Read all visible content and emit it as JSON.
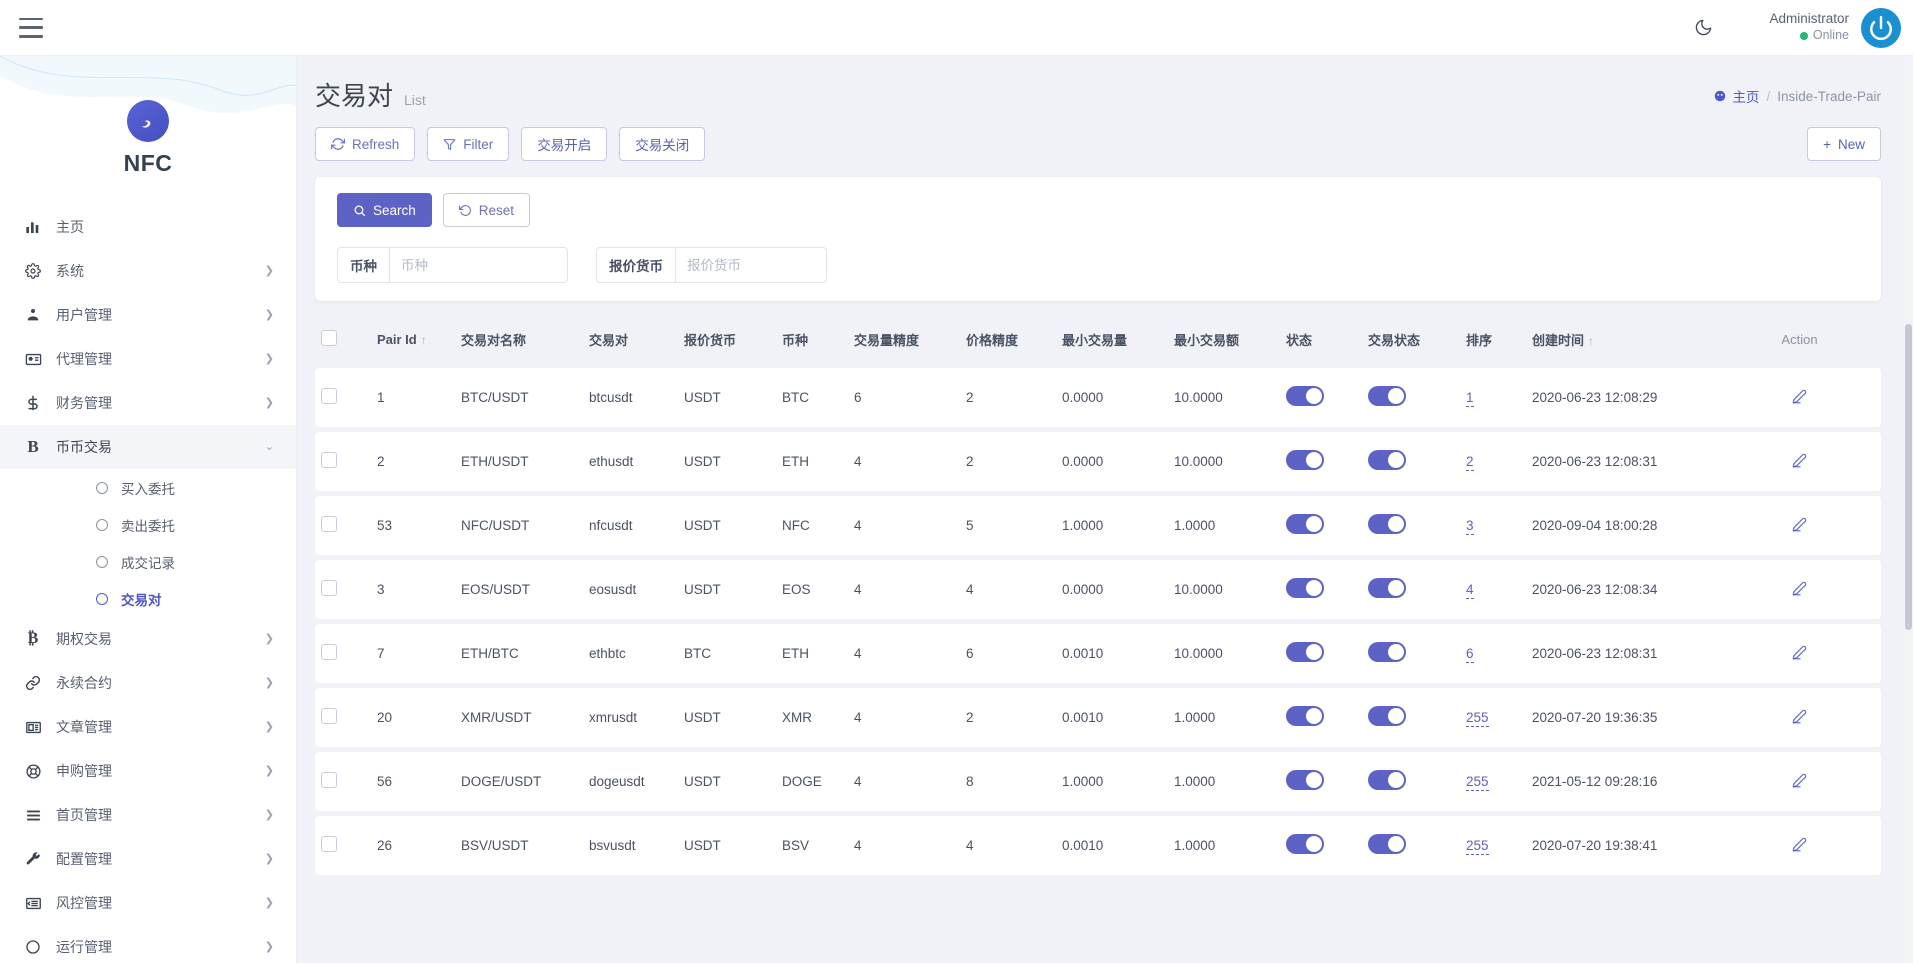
{
  "topbar": {
    "menu_toggle": "hamburger-menu",
    "theme_icon": "moon-icon",
    "user_name": "Administrator",
    "user_status": "Online",
    "avatar_icon": "power-avatar"
  },
  "sidebar": {
    "brand_name": "NFC",
    "items": [
      {
        "label": "主页",
        "icon": "bar-chart-icon",
        "expandable": false,
        "active": false
      },
      {
        "label": "系统",
        "icon": "gear-icon",
        "expandable": true,
        "active": false
      },
      {
        "label": "用户管理",
        "icon": "users-icon",
        "expandable": true,
        "active": false
      },
      {
        "label": "代理管理",
        "icon": "id-card-icon",
        "expandable": true,
        "active": false
      },
      {
        "label": "财务管理",
        "icon": "dollar-icon",
        "expandable": true,
        "active": false
      },
      {
        "label": "币币交易",
        "icon": "letter-b-icon",
        "expandable": true,
        "active": true
      }
    ],
    "submenu": [
      {
        "label": "买入委托",
        "current": false
      },
      {
        "label": "卖出委托",
        "current": false
      },
      {
        "label": "成交记录",
        "current": false
      },
      {
        "label": "交易对",
        "current": true
      }
    ],
    "items_after": [
      {
        "label": "期权交易",
        "icon": "bitcoin-icon",
        "expandable": true
      },
      {
        "label": "永续合约",
        "icon": "link-icon",
        "expandable": true
      },
      {
        "label": "文章管理",
        "icon": "newspaper-icon",
        "expandable": true
      },
      {
        "label": "申购管理",
        "icon": "lifebuoy-icon",
        "expandable": true
      },
      {
        "label": "首页管理",
        "icon": "stack-icon",
        "expandable": true
      },
      {
        "label": "配置管理",
        "icon": "wrench-icon",
        "expandable": true
      },
      {
        "label": "风控管理",
        "icon": "list-icon",
        "expandable": true
      },
      {
        "label": "运行管理",
        "icon": "circle-icon",
        "expandable": true
      }
    ]
  },
  "page": {
    "title": "交易对",
    "subtitle": "List",
    "breadcrumb_home": "主页",
    "breadcrumb_sep": "/",
    "breadcrumb_current": "Inside-Trade-Pair"
  },
  "toolbar": {
    "refresh": "Refresh",
    "filter": "Filter",
    "trade_open": "交易开启",
    "trade_close": "交易关闭",
    "new": "New",
    "new_plus": "+"
  },
  "search_panel": {
    "search_button": "Search",
    "reset_button": "Reset",
    "fields": [
      {
        "label": "币种",
        "value": "",
        "placeholder": "币种"
      },
      {
        "label": "报价货币",
        "value": "",
        "placeholder": "报价货币"
      }
    ]
  },
  "table": {
    "columns": [
      {
        "key": "checkbox",
        "label": ""
      },
      {
        "key": "pair_id",
        "label": "Pair Id",
        "sorted": true
      },
      {
        "key": "pair_name",
        "label": "交易对名称"
      },
      {
        "key": "pair",
        "label": "交易对"
      },
      {
        "key": "quote",
        "label": "报价货币"
      },
      {
        "key": "coin",
        "label": "币种"
      },
      {
        "key": "amt_prec",
        "label": "交易量精度"
      },
      {
        "key": "price_prec",
        "label": "价格精度"
      },
      {
        "key": "min_amount",
        "label": "最小交易量"
      },
      {
        "key": "min_total",
        "label": "最小交易额"
      },
      {
        "key": "status",
        "label": "状态"
      },
      {
        "key": "trade_status",
        "label": "交易状态"
      },
      {
        "key": "sort",
        "label": "排序"
      },
      {
        "key": "created",
        "label": "创建时间",
        "sorted": true
      },
      {
        "key": "action",
        "label": "Action"
      }
    ],
    "rows": [
      {
        "pair_id": "1",
        "pair_name": "BTC/USDT",
        "pair": "btcusdt",
        "quote": "USDT",
        "coin": "BTC",
        "amt_prec": "6",
        "price_prec": "2",
        "min_amount": "0.0000",
        "min_total": "10.0000",
        "status": true,
        "trade_status": true,
        "sort": "1",
        "created": "2020-06-23 12:08:29"
      },
      {
        "pair_id": "2",
        "pair_name": "ETH/USDT",
        "pair": "ethusdt",
        "quote": "USDT",
        "coin": "ETH",
        "amt_prec": "4",
        "price_prec": "2",
        "min_amount": "0.0000",
        "min_total": "10.0000",
        "status": true,
        "trade_status": true,
        "sort": "2",
        "created": "2020-06-23 12:08:31"
      },
      {
        "pair_id": "53",
        "pair_name": "NFC/USDT",
        "pair": "nfcusdt",
        "quote": "USDT",
        "coin": "NFC",
        "amt_prec": "4",
        "price_prec": "5",
        "min_amount": "1.0000",
        "min_total": "1.0000",
        "status": true,
        "trade_status": true,
        "sort": "3",
        "created": "2020-09-04 18:00:28"
      },
      {
        "pair_id": "3",
        "pair_name": "EOS/USDT",
        "pair": "eosusdt",
        "quote": "USDT",
        "coin": "EOS",
        "amt_prec": "4",
        "price_prec": "4",
        "min_amount": "0.0000",
        "min_total": "10.0000",
        "status": true,
        "trade_status": true,
        "sort": "4",
        "created": "2020-06-23 12:08:34"
      },
      {
        "pair_id": "7",
        "pair_name": "ETH/BTC",
        "pair": "ethbtc",
        "quote": "BTC",
        "coin": "ETH",
        "amt_prec": "4",
        "price_prec": "6",
        "min_amount": "0.0010",
        "min_total": "10.0000",
        "status": true,
        "trade_status": true,
        "sort": "6",
        "created": "2020-06-23 12:08:31"
      },
      {
        "pair_id": "20",
        "pair_name": "XMR/USDT",
        "pair": "xmrusdt",
        "quote": "USDT",
        "coin": "XMR",
        "amt_prec": "4",
        "price_prec": "2",
        "min_amount": "0.0010",
        "min_total": "1.0000",
        "status": true,
        "trade_status": true,
        "sort": "255",
        "created": "2020-07-20 19:36:35"
      },
      {
        "pair_id": "56",
        "pair_name": "DOGE/USDT",
        "pair": "dogeusdt",
        "quote": "USDT",
        "coin": "DOGE",
        "amt_prec": "4",
        "price_prec": "8",
        "min_amount": "1.0000",
        "min_total": "1.0000",
        "status": true,
        "trade_status": true,
        "sort": "255",
        "created": "2021-05-12 09:28:16"
      },
      {
        "pair_id": "26",
        "pair_name": "BSV/USDT",
        "pair": "bsvusdt",
        "quote": "USDT",
        "coin": "BSV",
        "amt_prec": "4",
        "price_prec": "4",
        "min_amount": "0.0010",
        "min_total": "1.0000",
        "status": true,
        "trade_status": true,
        "sort": "255",
        "created": "2020-07-20 19:38:41"
      }
    ]
  },
  "colors": {
    "accent": "#5c63c4",
    "page_bg": "#f0f2f7",
    "online": "#23b776",
    "avatar": "#1a8fd1"
  }
}
